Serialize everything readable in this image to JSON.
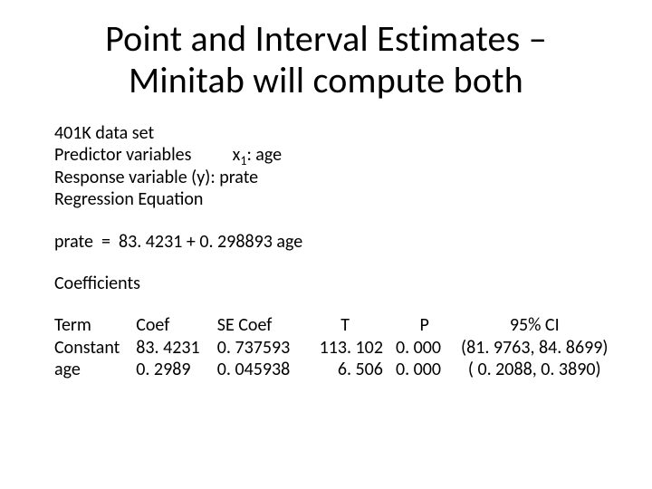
{
  "title_line1": "Point and Interval Estimates –",
  "title_line2": "Minitab will compute both",
  "dataset_line": "401K data set",
  "predictor_label": "Predictor variables",
  "predictor_x_pre": "x",
  "predictor_x_sub": "1",
  "predictor_x_post": ": age",
  "response_line": "Response variable (y): prate",
  "regeqn_header": "Regression Equation",
  "regeqn_line": "prate  =  83. 4231 + 0. 298893 age",
  "coefs_header": "Coefficients",
  "table": {
    "headers": {
      "term": "Term",
      "coef": "Coef",
      "se": "SE Coef",
      "t": "T",
      "p": "P",
      "ci": "95% CI"
    },
    "rows": [
      {
        "term": "Constant",
        "coef": "83. 4231",
        "se": "0. 737593",
        "t": "113. 102",
        "p": "0. 000",
        "ci": "(81. 9763, 84. 8699)"
      },
      {
        "term": "age",
        "coef": "  0. 2989",
        "se": "0. 045938",
        "t": "6. 506",
        "p": "0. 000",
        "ci": "( 0. 2088,  0. 3890)"
      }
    ]
  },
  "chart_data": {
    "type": "table",
    "title": "Coefficients",
    "columns": [
      "Term",
      "Coef",
      "SE Coef",
      "T",
      "P",
      "95% CI"
    ],
    "rows": [
      [
        "Constant",
        83.4231,
        0.737593,
        113.102,
        0.0,
        "(81.9763, 84.8699)"
      ],
      [
        "age",
        0.2989,
        0.045938,
        6.506,
        0.0,
        "(0.2088, 0.3890)"
      ]
    ],
    "regression_equation": "prate = 83.4231 + 0.298893 * age",
    "response": "prate",
    "predictors": [
      "age"
    ],
    "dataset": "401K"
  }
}
